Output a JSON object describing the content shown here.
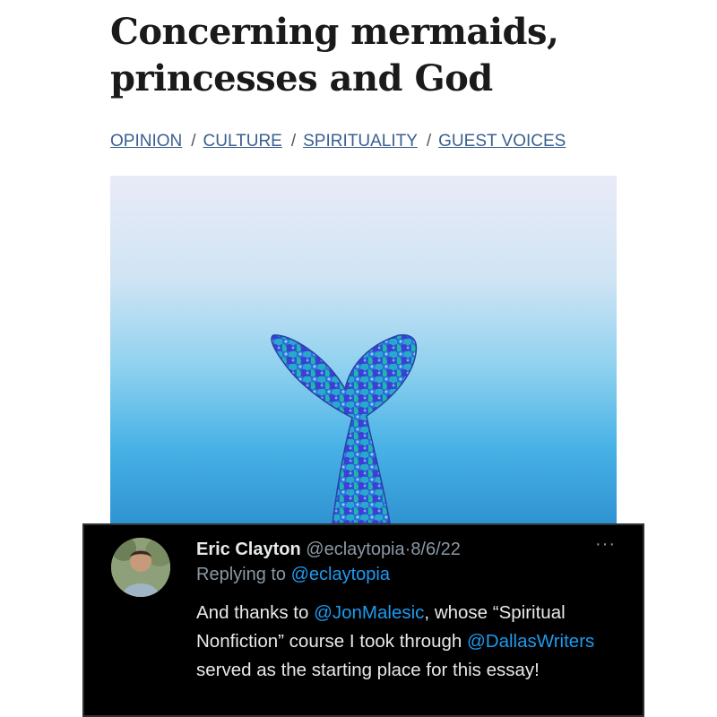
{
  "article": {
    "title_line1": "Concerning mermaids,",
    "title_line2": "princesses and God",
    "breadcrumbs": [
      "OPINION",
      "CULTURE",
      "SPIRITUALITY",
      "GUEST VOICES"
    ],
    "breadcrumb_separator": "/"
  },
  "tweet": {
    "author_name": "Eric Clayton",
    "author_handle": "@eclaytopia",
    "dot": "·",
    "date": "8/6/22",
    "more": "···",
    "replying_prefix": "Replying to ",
    "replying_handle": "@eclaytopia",
    "body_1": "And thanks to ",
    "mention_1": "@JonMalesic",
    "body_2": ", whose “Spiritual Nonfiction” course I took through ",
    "mention_2": "@DallasWriters",
    "body_3": " served as the starting place for this essay!"
  },
  "colors": {
    "link_blue": "#3a5f8f",
    "tweet_bg": "#000000",
    "mention_blue": "#1d9bf0",
    "muted_gray": "#8b98a5"
  }
}
